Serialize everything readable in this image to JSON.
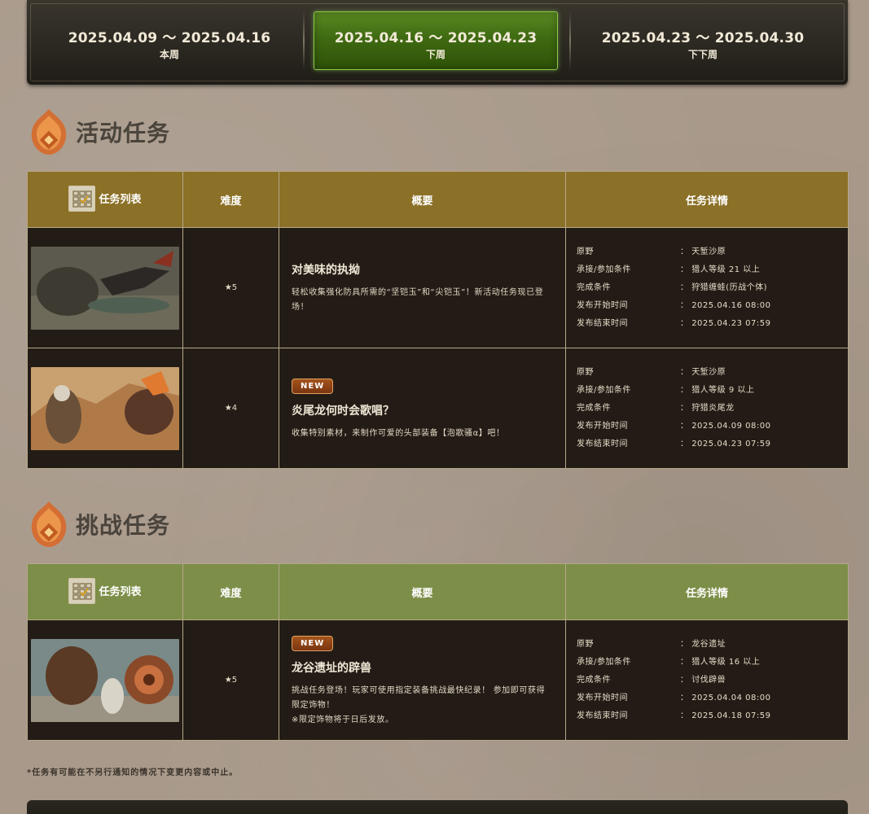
{
  "weeks": [
    {
      "range": "2025.04.09 ～ 2025.04.16",
      "label": "本周"
    },
    {
      "range": "2025.04.16 ～ 2025.04.23",
      "label": "下周"
    },
    {
      "range": "2025.04.23 ～ 2025.04.30",
      "label": "下下周"
    }
  ],
  "colors": {
    "event_header": "#8b7027",
    "challenge_header": "#7d8e48",
    "active_tab": "#3f6a12",
    "cell_bg": "#231c16",
    "new_badge": "#a4541c"
  },
  "event": {
    "title": "活动任务",
    "headers": {
      "list": "任务列表",
      "difficulty": "难度",
      "summary": "概要",
      "details": "任务详情"
    },
    "quests": [
      {
        "badge": "",
        "stars": "★5",
        "name": "对美味的执拗",
        "desc": "轻松收集强化防具所需的“坚铠玉”和“尖铠玉”！新活动任务现已登场！",
        "desc2": "",
        "details": [
          {
            "k": "原野",
            "v": "天堑沙原"
          },
          {
            "k": "承接/参加条件",
            "v": "猎人等级 21 以上"
          },
          {
            "k": "完成条件",
            "v": "狩猎缠蛙(历战个体)"
          },
          {
            "k": "发布开始时间",
            "v": "2025.04.16 08:00"
          },
          {
            "k": "发布结束时间",
            "v": "2025.04.23 07:59"
          }
        ]
      },
      {
        "badge": "NEW",
        "stars": "★4",
        "name": "炎尾龙何时会歌唱？",
        "desc": "收集特别素材，来制作可爱的头部装备【泡歌骚α】吧！",
        "desc2": "",
        "details": [
          {
            "k": "原野",
            "v": "天堑沙原"
          },
          {
            "k": "承接/参加条件",
            "v": "猎人等级 9 以上"
          },
          {
            "k": "完成条件",
            "v": "狩猎炎尾龙"
          },
          {
            "k": "发布开始时间",
            "v": "2025.04.09 08:00"
          },
          {
            "k": "发布结束时间",
            "v": "2025.04.23 07:59"
          }
        ]
      }
    ]
  },
  "challenge": {
    "title": "挑战任务",
    "headers": {
      "list": "任务列表",
      "difficulty": "难度",
      "summary": "概要",
      "details": "任务详情"
    },
    "quests": [
      {
        "badge": "NEW",
        "stars": "★5",
        "name": "龙谷遗址的辟兽",
        "desc": "挑战任务登场！玩家可使用指定装备挑战最快纪录！ 参加即可获得限定饰物！",
        "desc2": "※限定饰物将于日后发放。",
        "details": [
          {
            "k": "原野",
            "v": "龙谷遗址"
          },
          {
            "k": "承接/参加条件",
            "v": "猎人等级 16 以上"
          },
          {
            "k": "完成条件",
            "v": "讨伐辟兽"
          },
          {
            "k": "发布开始时间",
            "v": "2025.04.04 08:00"
          },
          {
            "k": "发布结束时间",
            "v": "2025.04.18 07:59"
          }
        ]
      }
    ]
  },
  "footnote": "*任务有可能在不另行通知的情况下变更内容或中止。"
}
